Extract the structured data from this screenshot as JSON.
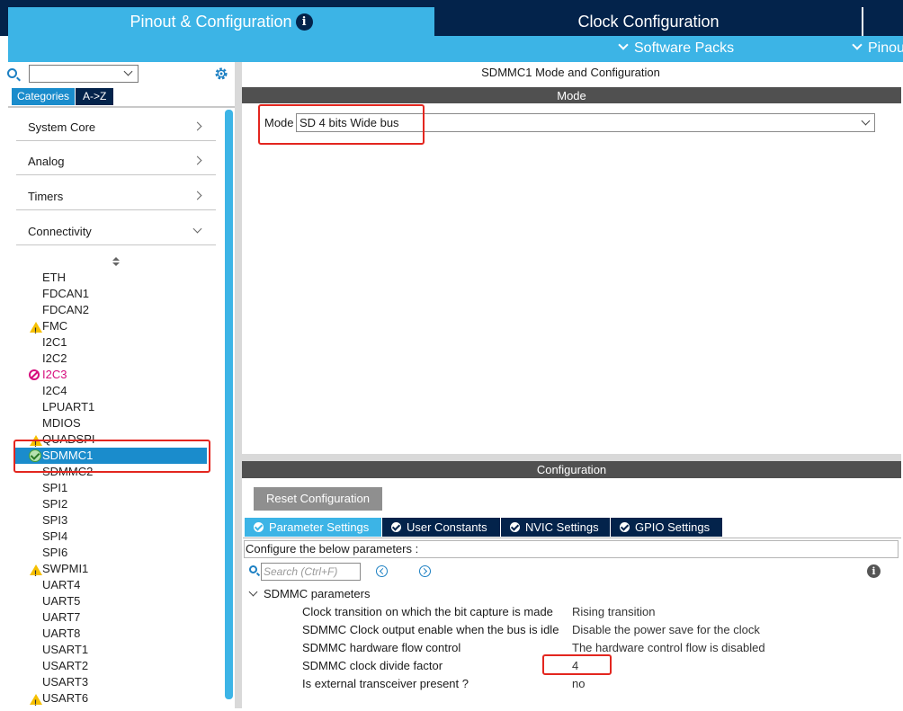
{
  "header": {
    "tab_pinout": "Pinout & Configuration",
    "tab_clock": "Clock Configuration",
    "software_packs": "Software Packs",
    "pinout": "Pinout"
  },
  "left": {
    "tab_categories": "Categories",
    "tab_az": "A->Z",
    "categories": [
      {
        "label": "System Core",
        "expanded": false
      },
      {
        "label": "Analog",
        "expanded": false
      },
      {
        "label": "Timers",
        "expanded": false
      },
      {
        "label": "Connectivity",
        "expanded": true
      }
    ],
    "peripherals": [
      {
        "label": "ETH",
        "status": "none"
      },
      {
        "label": "FDCAN1",
        "status": "none"
      },
      {
        "label": "FDCAN2",
        "status": "none"
      },
      {
        "label": "FMC",
        "status": "warning"
      },
      {
        "label": "I2C1",
        "status": "none"
      },
      {
        "label": "I2C2",
        "status": "none"
      },
      {
        "label": "I2C3",
        "status": "disabled"
      },
      {
        "label": "I2C4",
        "status": "none"
      },
      {
        "label": "LPUART1",
        "status": "none"
      },
      {
        "label": "MDIOS",
        "status": "none"
      },
      {
        "label": "QUADSPI",
        "status": "warning"
      },
      {
        "label": "SDMMC1",
        "status": "ok"
      },
      {
        "label": "SDMMC2",
        "status": "none"
      },
      {
        "label": "SPI1",
        "status": "none"
      },
      {
        "label": "SPI2",
        "status": "none"
      },
      {
        "label": "SPI3",
        "status": "none"
      },
      {
        "label": "SPI4",
        "status": "none"
      },
      {
        "label": "SPI6",
        "status": "none"
      },
      {
        "label": "SWPMI1",
        "status": "warning"
      },
      {
        "label": "UART4",
        "status": "none"
      },
      {
        "label": "UART5",
        "status": "none"
      },
      {
        "label": "UART7",
        "status": "none"
      },
      {
        "label": "UART8",
        "status": "none"
      },
      {
        "label": "USART1",
        "status": "none"
      },
      {
        "label": "USART2",
        "status": "none"
      },
      {
        "label": "USART3",
        "status": "none"
      },
      {
        "label": "USART6",
        "status": "warning"
      }
    ]
  },
  "right": {
    "title": "SDMMC1 Mode and Configuration",
    "mode_header": "Mode",
    "mode_label": "Mode",
    "mode_value": "SD 4 bits Wide bus",
    "config_header": "Configuration",
    "reset_button": "Reset Configuration",
    "tabs": [
      "Parameter Settings",
      "User Constants",
      "NVIC Settings",
      "GPIO Settings"
    ],
    "hint": "Configure the below parameters :",
    "search_placeholder": "Search (Ctrl+F)",
    "group": "SDMMC parameters",
    "params": [
      {
        "name": "Clock transition on which the bit capture is made",
        "value": "Rising transition"
      },
      {
        "name": "SDMMC Clock output enable when the bus is idle",
        "value": "Disable the power save for the clock"
      },
      {
        "name": "SDMMC hardware flow control",
        "value": "The hardware control flow is disabled"
      },
      {
        "name": "SDMMC clock divide factor",
        "value": "4"
      },
      {
        "name": "Is external transceiver present ?",
        "value": "no"
      }
    ]
  },
  "colors": {
    "navy": "#03234b",
    "accent_blue": "#3cb4e6",
    "selected_blue": "#1a8ccc",
    "warning": "#f6c000",
    "disabled": "#d60c7c",
    "highlight_red": "#e3261f"
  }
}
